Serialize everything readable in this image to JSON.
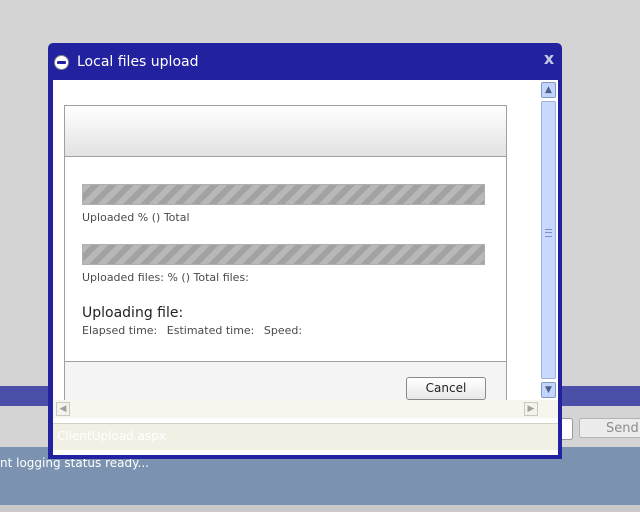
{
  "background": {
    "send_label": "Send",
    "status_text": "nt logging status ready..."
  },
  "dialog": {
    "title": "Local files upload",
    "close_symbol": "x",
    "total_label": "Uploaded % () Total",
    "files_label": "Uploaded files: % () Total files:",
    "uploading_label": "Uploading file:",
    "elapsed_label": "Elapsed time:",
    "estimated_label": "Estimated time:",
    "speed_label": "Speed:",
    "cancel_label": "Cancel",
    "status_text": "ClientUpload.aspx",
    "total_progress": 0,
    "files_progress": 0
  },
  "icons": [
    "app-globe-icon",
    "close-icon",
    "scroll-up-icon",
    "scroll-down-icon",
    "scroll-left-icon",
    "scroll-right-icon"
  ],
  "colors": {
    "titlebar": "#2222a0",
    "background_band": "#4b4fa8",
    "status_area": "#7b93b0"
  }
}
